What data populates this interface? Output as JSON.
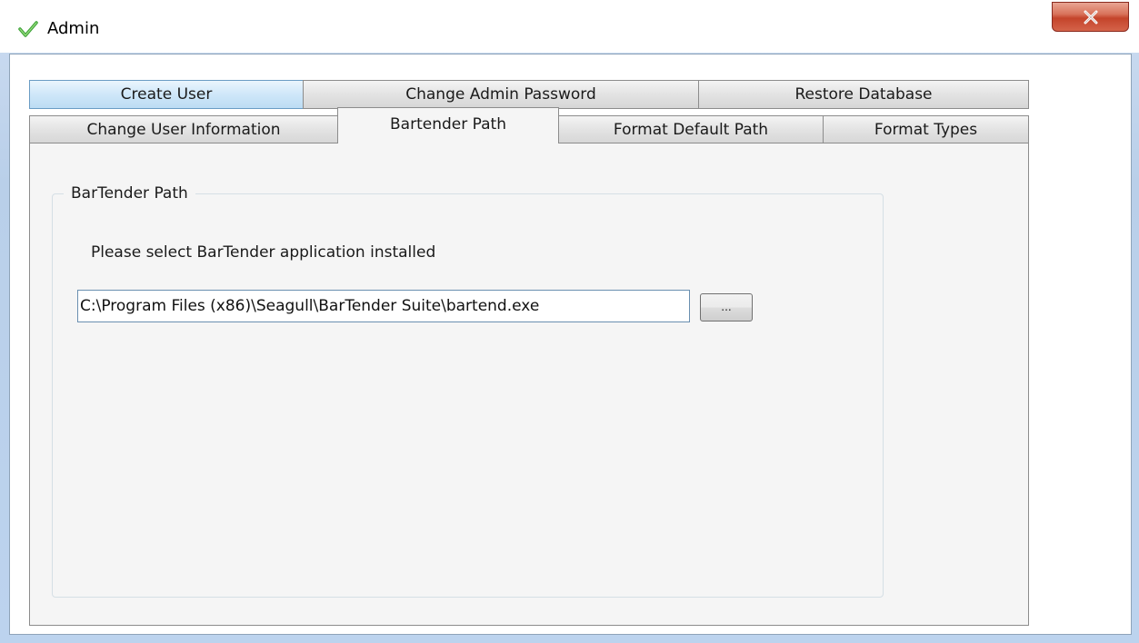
{
  "window": {
    "title": "Admin",
    "close_icon": "close-x-icon",
    "app_icon": "green-checkmark-icon"
  },
  "tabs": {
    "row_top": [
      {
        "label": "Create User"
      },
      {
        "label": "Change Admin Password"
      },
      {
        "label": "Restore Database"
      }
    ],
    "row_bottom": [
      {
        "label": "Change User Information"
      },
      {
        "label": "Bartender Path"
      },
      {
        "label": "Format Default Path"
      },
      {
        "label": "Format Types"
      }
    ],
    "selected": "Bartender Path"
  },
  "bartender_path": {
    "group_title": "BarTender Path",
    "instruction": "Please select BarTender application installed",
    "path_value": "C:\\Program Files (x86)\\Seagull\\BarTender Suite\\bartend.exe",
    "browse_label": "..."
  },
  "colors": {
    "close_button": "#c4442b",
    "selected_tab_bg": "#f5f5f5",
    "hover_tab_bg": "#cfe7f9"
  }
}
